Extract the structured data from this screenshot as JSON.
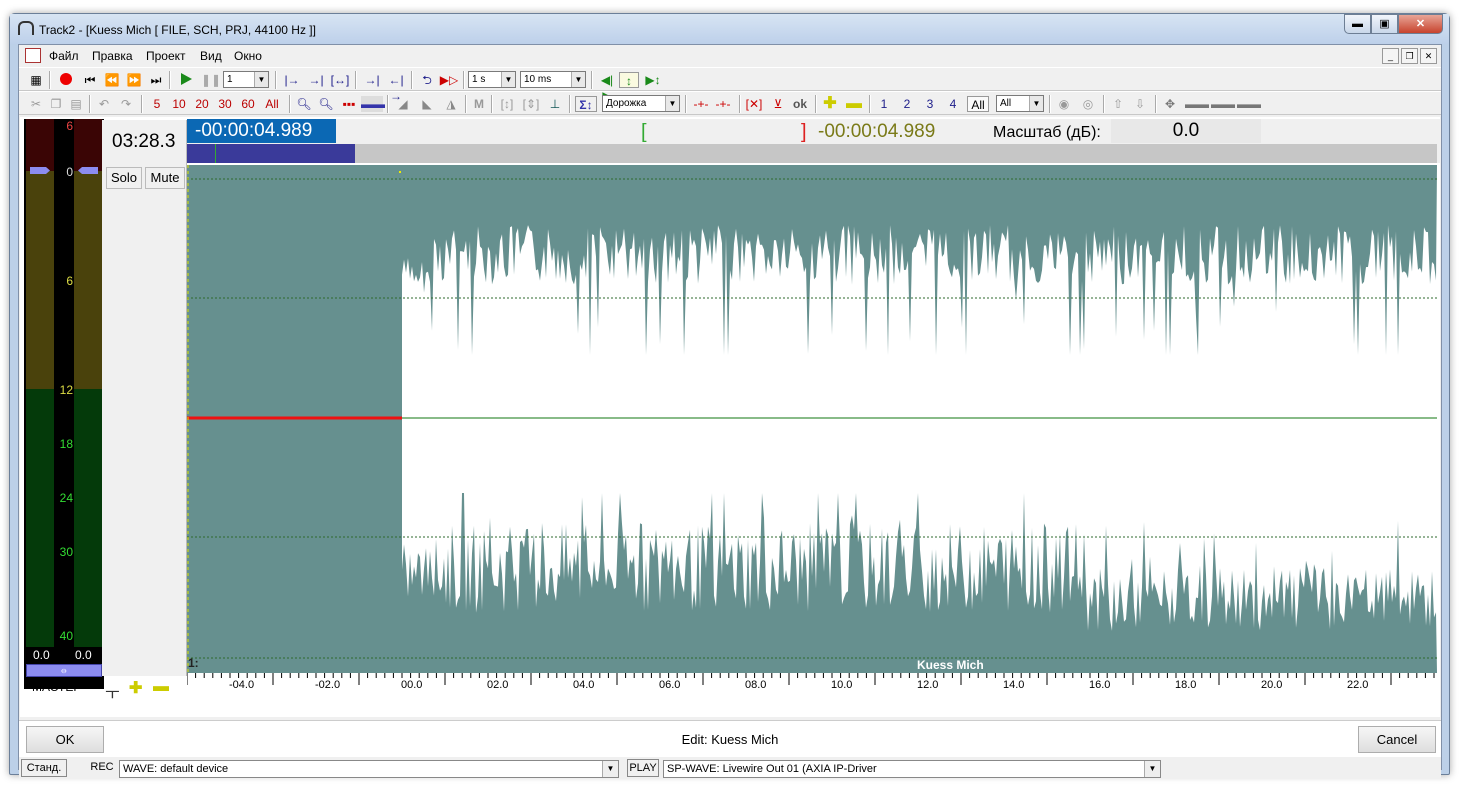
{
  "window": {
    "title": "Track2 - [Kuess Mich [ FILE, SCH, PRJ, 44100 Hz ]]",
    "min_label": "▬",
    "max_label": "▣",
    "close_label": "✕"
  },
  "menu": [
    "Файл",
    "Правка",
    "Проект",
    "Вид",
    "Окно"
  ],
  "toolbar1": {
    "record_count_value": "1",
    "time_step_value": "1 s",
    "time_fine_value": "10 ms"
  },
  "toolbar2": {
    "numbers_group1": [
      "5",
      "10",
      "20",
      "30",
      "60",
      "All"
    ],
    "track_combo_value": "Дорожка",
    "track_numbers": [
      "1",
      "2",
      "3",
      "4",
      "All"
    ],
    "all_combo_value": "All",
    "m_label": "M",
    "ok_label": "ok"
  },
  "meter": {
    "scale": [
      "6",
      "0",
      "6",
      "12",
      "18",
      "24",
      "30",
      "40"
    ],
    "left_value": "0.0",
    "right_value": "0.0",
    "link_symbol": "⦵",
    "master_label": "МАСТЕР"
  },
  "track": {
    "clock": "03:28.3",
    "solo_label": "Solo",
    "mute_label": "Mute",
    "number_label": "1:",
    "clip_name": "Kuess Mich"
  },
  "header": {
    "position_time": "-00:00:04.989",
    "bracket_left": "[",
    "bracket_right": "]",
    "selection_time": "-00:00:04.989",
    "scale_label": "Масштаб (дБ):",
    "scale_value": "0.0"
  },
  "ruler": {
    "labels": [
      "-04.0",
      "-02.0",
      "00.0",
      "02.0",
      "04.0",
      "06.0",
      "08.0",
      "10.0",
      "12.0",
      "14.0",
      "16.0",
      "18.0",
      "20.0",
      "22.0"
    ]
  },
  "dialog": {
    "ok_label": "OK",
    "edit_label": "Edit: Kuess Mich",
    "cancel_label": "Cancel"
  },
  "status": {
    "mode_button": "Станд.",
    "rec_label": "REC",
    "rec_device": "WAVE: default device",
    "play_label": "PLAY",
    "play_device": "SP-WAVE: Livewire Out 01 (AXIA IP-Driver"
  },
  "colors": {
    "wave_fill": "#66908f",
    "wave_bg": "#ffffff",
    "position_box": "#0b68b4",
    "overview_selection": "#3a3a9a",
    "playhead_red": "#ee1111",
    "center_line": "#117711"
  }
}
